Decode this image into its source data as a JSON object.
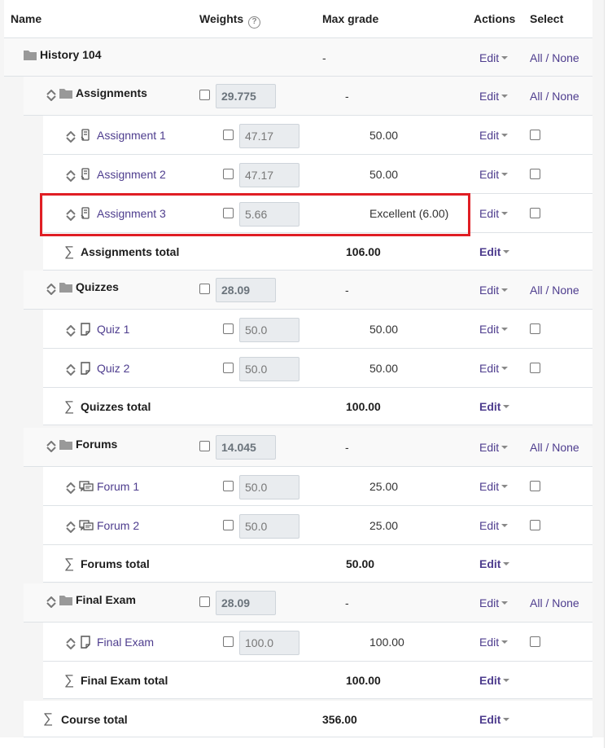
{
  "header": {
    "name": "Name",
    "weights": "Weights",
    "max_grade": "Max grade",
    "actions": "Actions",
    "select": "Select"
  },
  "common": {
    "edit": "Edit",
    "all": "All",
    "slash": "/",
    "none": "None",
    "help_glyph": "?"
  },
  "course": {
    "name": "History 104",
    "max": "-"
  },
  "categories": [
    {
      "name": "Assignments",
      "weight": "29.775",
      "max": "-",
      "items": [
        {
          "name": "Assignment 1",
          "weight": "47.17",
          "max": "50.00",
          "icon": "assignment-icon"
        },
        {
          "name": "Assignment 2",
          "weight": "47.17",
          "max": "50.00",
          "icon": "assignment-icon"
        },
        {
          "name": "Assignment 3",
          "weight": "5.66",
          "max": "Excellent (6.00)",
          "icon": "assignment-icon"
        }
      ],
      "total_label": "Assignments total",
      "total_max": "106.00"
    },
    {
      "name": "Quizzes",
      "weight": "28.09",
      "max": "-",
      "items": [
        {
          "name": "Quiz 1",
          "weight": "50.0",
          "max": "50.00",
          "icon": "quiz-icon"
        },
        {
          "name": "Quiz 2",
          "weight": "50.0",
          "max": "50.00",
          "icon": "quiz-icon"
        }
      ],
      "total_label": "Quizzes total",
      "total_max": "100.00"
    },
    {
      "name": "Forums",
      "weight": "14.045",
      "max": "-",
      "items": [
        {
          "name": "Forum 1",
          "weight": "50.0",
          "max": "25.00",
          "icon": "forum-icon"
        },
        {
          "name": "Forum 2",
          "weight": "50.0",
          "max": "25.00",
          "icon": "forum-icon"
        }
      ],
      "total_label": "Forums total",
      "total_max": "50.00"
    },
    {
      "name": "Final Exam",
      "weight": "28.09",
      "max": "-",
      "items": [
        {
          "name": "Final Exam",
          "weight": "100.0",
          "max": "100.00",
          "icon": "quiz-icon"
        }
      ],
      "total_label": "Final Exam total",
      "total_max": "100.00"
    }
  ],
  "course_total": {
    "label": "Course total",
    "max": "356.00"
  },
  "colors": {
    "link": "#4e3d8e",
    "highlight": "#e01e24"
  }
}
